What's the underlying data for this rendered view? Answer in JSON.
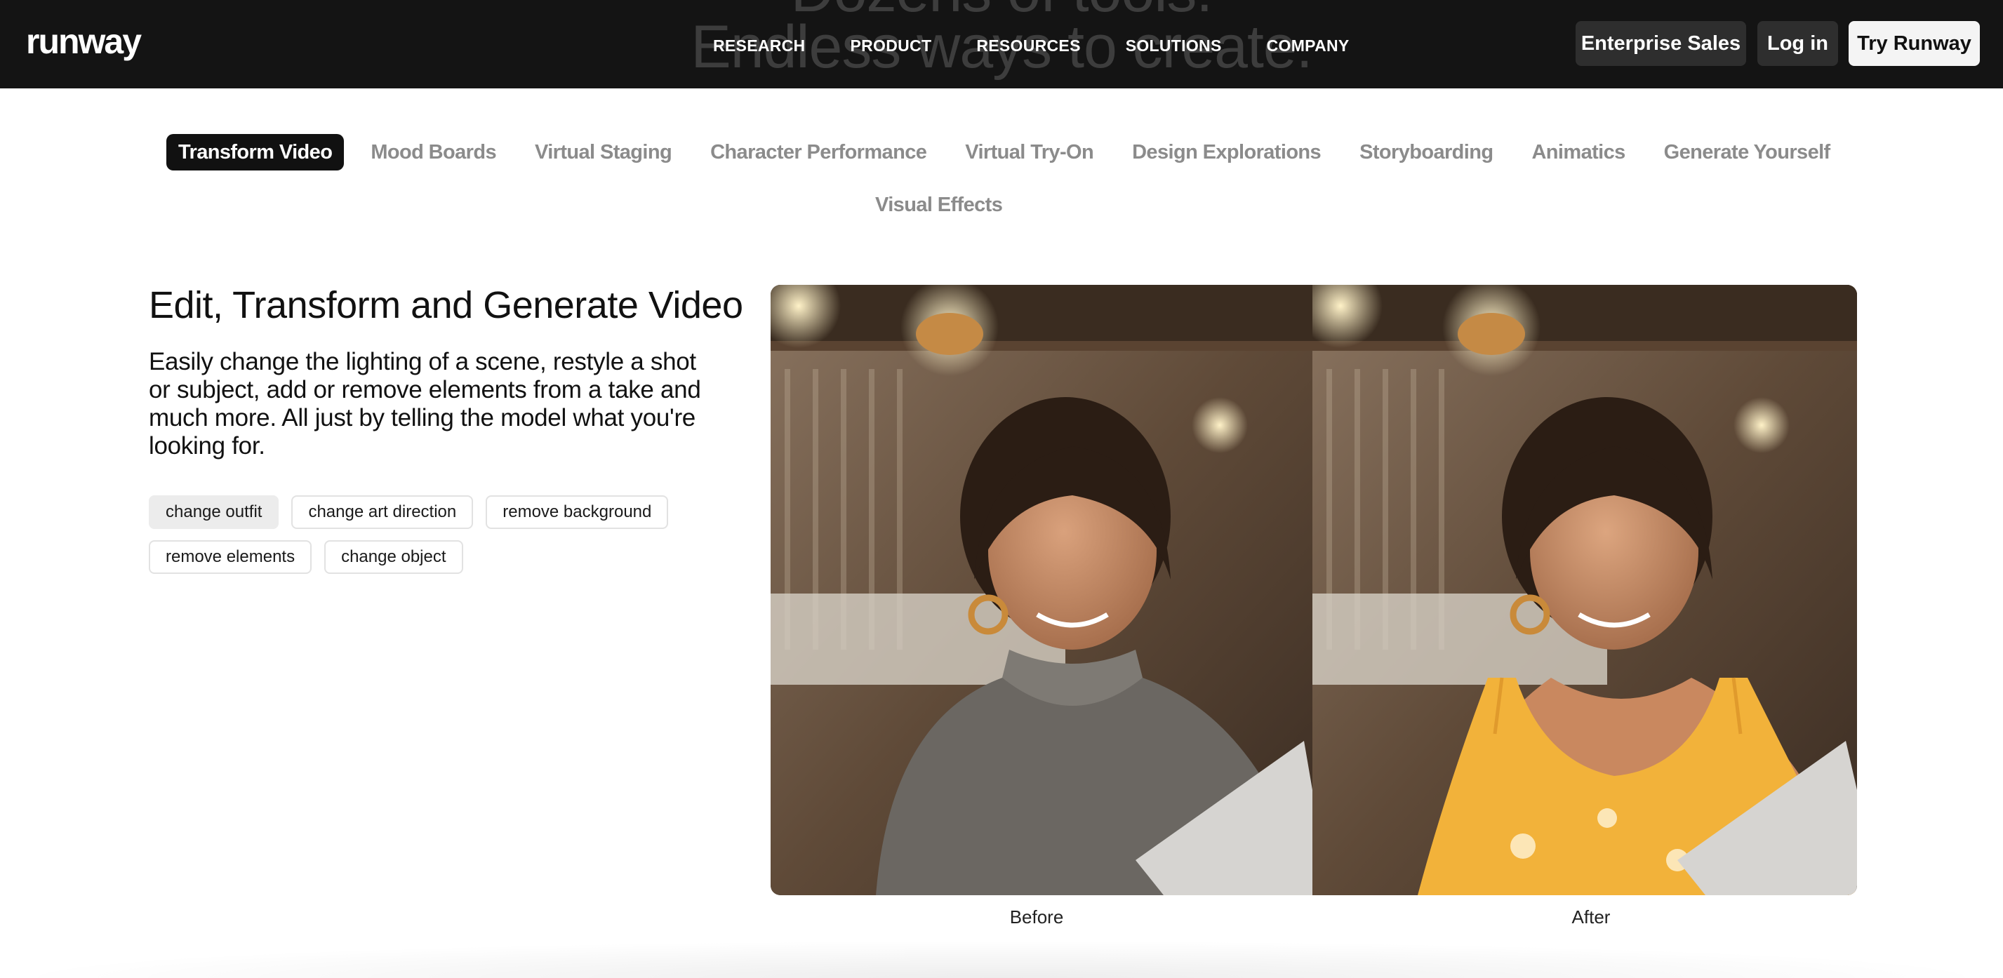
{
  "hero": {
    "line1": "Dozens of tools.",
    "line2": "Endless ways to create."
  },
  "header": {
    "logo": "runway",
    "nav": [
      "RESEARCH",
      "PRODUCT",
      "RESOURCES",
      "SOLUTIONS",
      "COMPANY"
    ],
    "enterprise_label": "Enterprise Sales",
    "login_label": "Log in",
    "try_label": "Try Runway"
  },
  "tabs": [
    "Transform Video",
    "Mood Boards",
    "Virtual Staging",
    "Character Performance",
    "Virtual Try-On",
    "Design Explorations",
    "Storyboarding",
    "Animatics",
    "Generate Yourself",
    "Visual Effects"
  ],
  "active_tab": "Transform Video",
  "section": {
    "title": "Edit, Transform and Generate Video",
    "description": "Easily change the lighting of a scene, restyle a shot or subject, add or remove elements from a take and much more. All just by telling the model what you're looking for."
  },
  "chips": [
    "change outfit",
    "change art direction",
    "remove background",
    "remove elements",
    "change object"
  ],
  "selected_chip": "change outfit",
  "comparison": {
    "before_label": "Before",
    "after_label": "After"
  },
  "colors": {
    "header_bg": "#141414",
    "active_tab_bg": "#111111",
    "sweater": "#6b6762",
    "dress": "#f2b23a"
  }
}
